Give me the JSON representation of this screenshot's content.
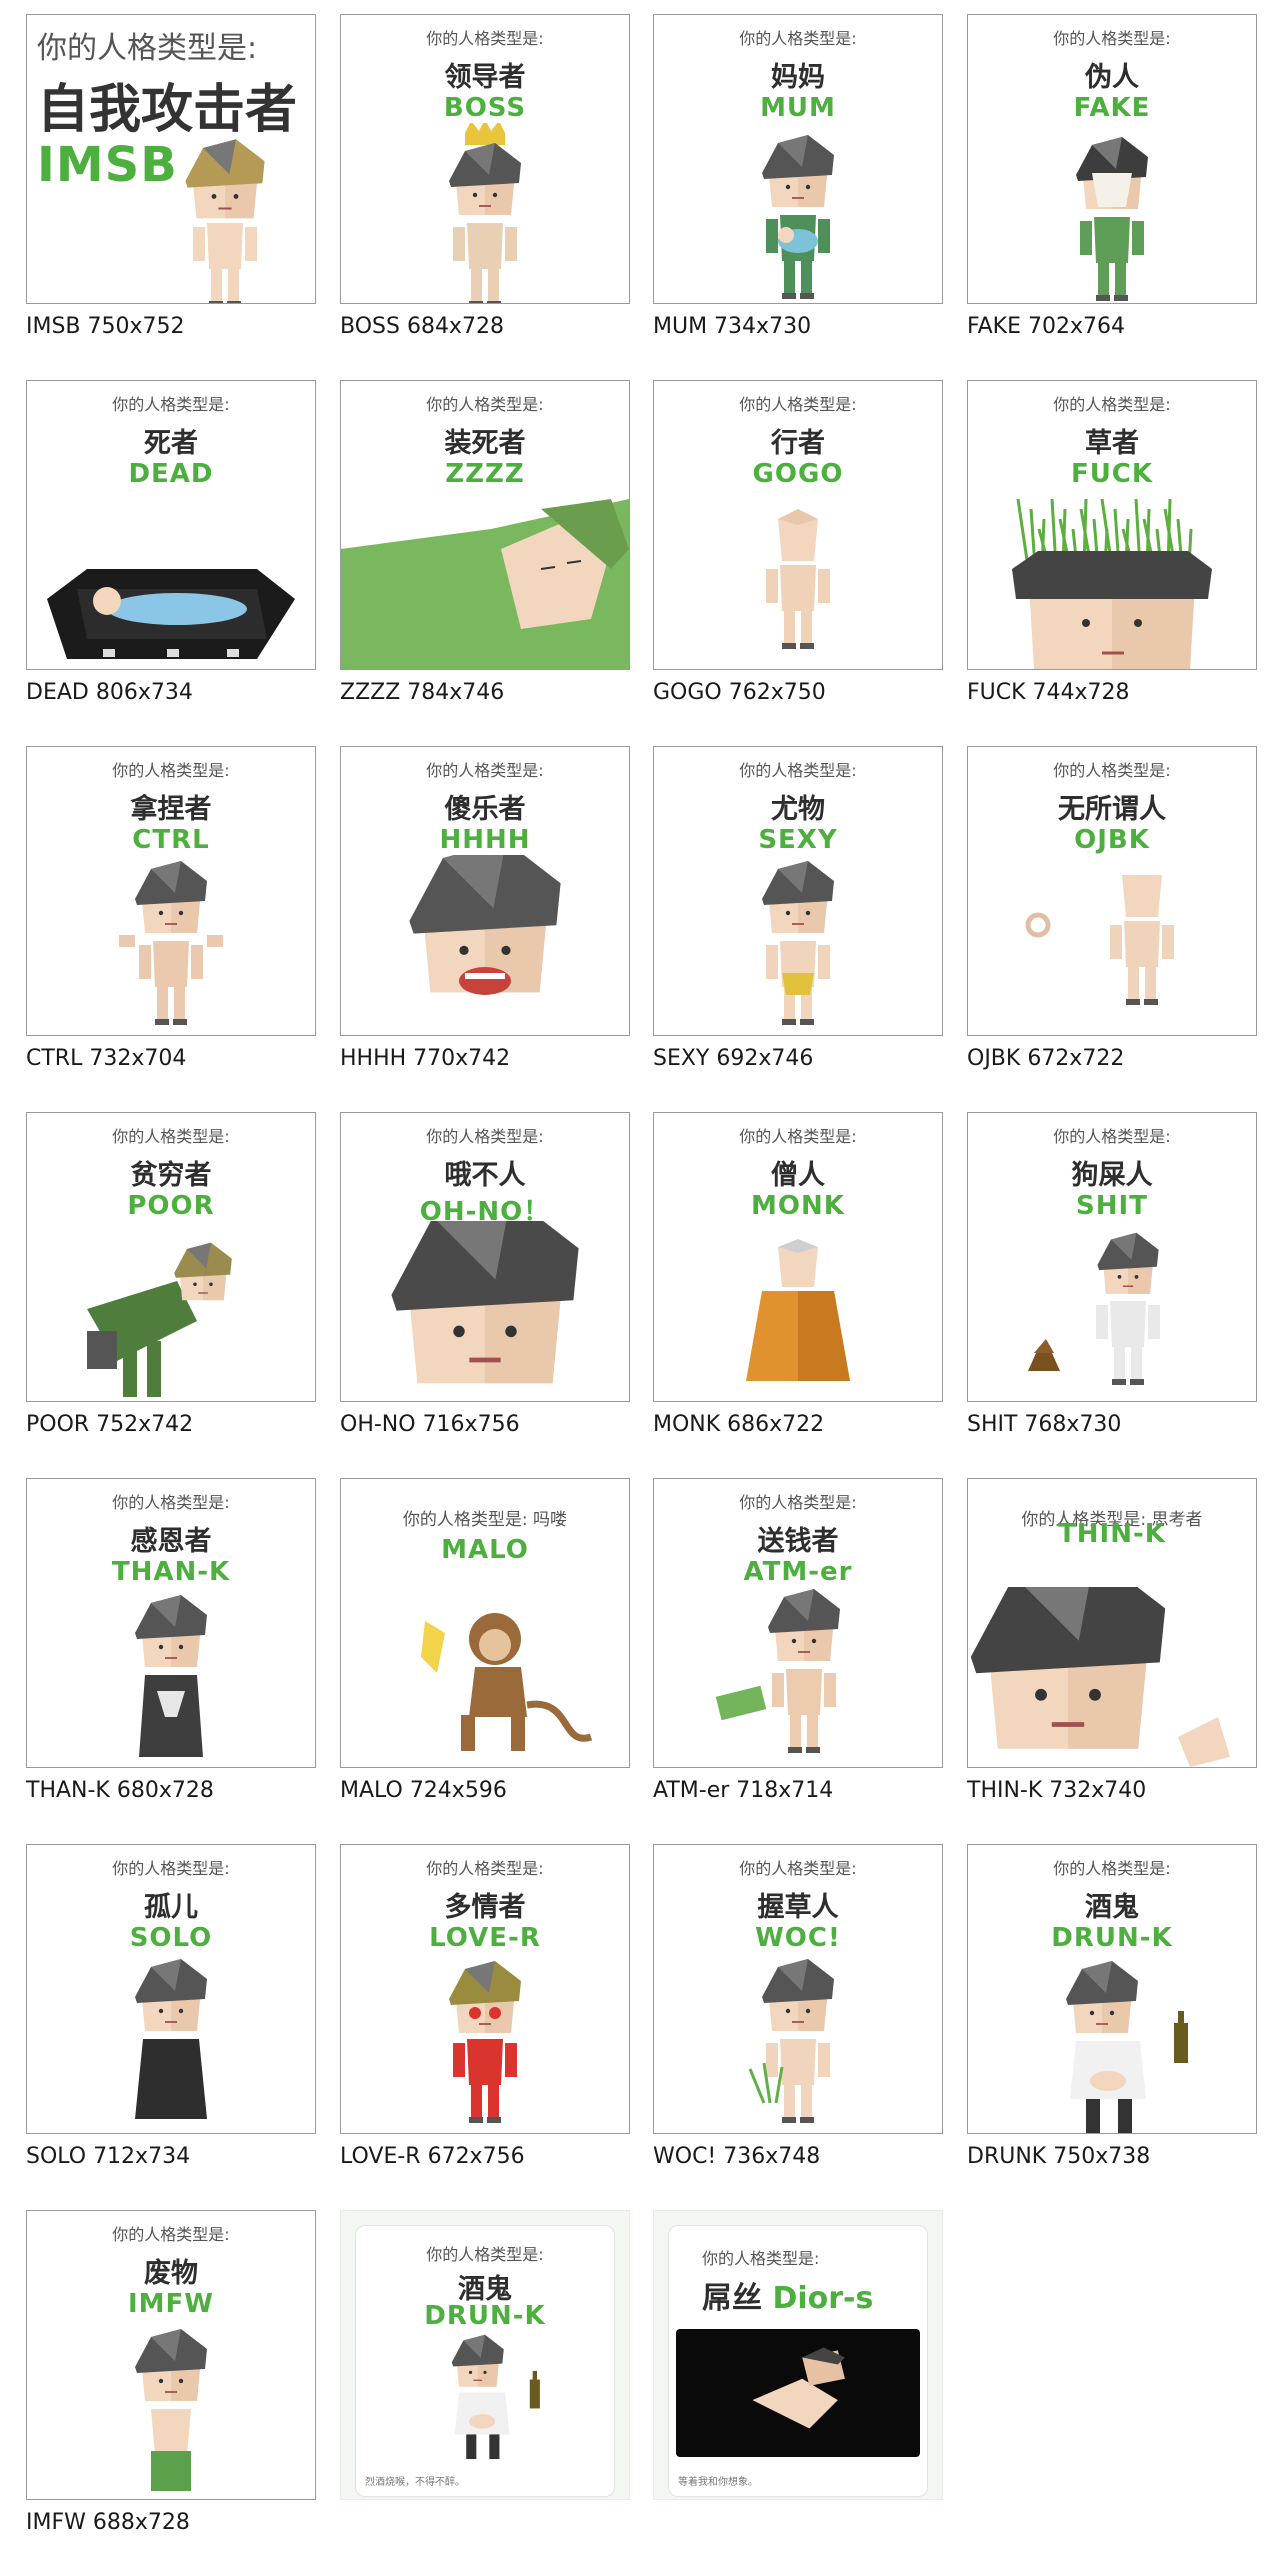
{
  "cards": [
    {
      "prompt": "你的人格类型是:",
      "name": "自我攻击者",
      "code": "IMSB",
      "caption": "IMSB 750x752",
      "icon": "blond-curly-haired-character-icon",
      "style": "big"
    },
    {
      "prompt": "你的人格类型是:",
      "name": "领导者",
      "code": "BOSS",
      "caption": "BOSS 684x728",
      "icon": "crowned-character-icon"
    },
    {
      "prompt": "你的人格类型是:",
      "name": "妈妈",
      "code": "MUM",
      "caption": "MUM 734x730",
      "icon": "character-holding-baby-icon"
    },
    {
      "prompt": "你的人格类型是:",
      "name": "伪人",
      "code": "FAKE",
      "caption": "FAKE 702x764",
      "icon": "masked-green-character-icon"
    },
    {
      "prompt": "你的人格类型是:",
      "name": "死者",
      "code": "DEAD",
      "caption": "DEAD 806x734",
      "icon": "character-in-coffin-icon"
    },
    {
      "prompt": "你的人格类型是:",
      "name": "装死者",
      "code": "ZZZZ",
      "caption": "ZZZZ 784x746",
      "icon": "sleeping-under-blanket-icon"
    },
    {
      "prompt": "你的人格类型是:",
      "name": "行者",
      "code": "GOGO",
      "caption": "GOGO 762x750",
      "icon": "walking-bald-character-icon"
    },
    {
      "prompt": "你的人格类型是:",
      "name": "草者",
      "code": "FUCK",
      "caption": "FUCK 744x728",
      "icon": "grass-haired-head-icon"
    },
    {
      "prompt": "你的人格类型是:",
      "name": "拿捏者",
      "code": "CTRL",
      "caption": "CTRL 732x704",
      "icon": "hands-up-character-icon"
    },
    {
      "prompt": "你的人格类型是:",
      "name": "傻乐者",
      "code": "HHHH",
      "caption": "HHHH 770x742",
      "icon": "laughing-character-icon"
    },
    {
      "prompt": "你的人格类型是:",
      "name": "尤物",
      "code": "SEXY",
      "caption": "SEXY 692x746",
      "icon": "posing-character-icon"
    },
    {
      "prompt": "你的人格类型是:",
      "name": "无所谓人",
      "code": "OJBK",
      "caption": "OJBK 672x722",
      "icon": "ok-gesture-character-icon"
    },
    {
      "prompt": "你的人格类型是:",
      "name": "贫穷者",
      "code": "POOR",
      "caption": "POOR 752x742",
      "icon": "bent-over-character-with-bag-icon"
    },
    {
      "prompt": "你的人格类型是:",
      "name": "哦不人",
      "code": "OH-NO！",
      "caption": "OH-NO 716x756",
      "icon": "worried-head-icon"
    },
    {
      "prompt": "你的人格类型是:",
      "name": "僧人",
      "code": "MONK",
      "caption": "MONK 686x722",
      "icon": "meditating-monk-icon"
    },
    {
      "prompt": "你的人格类型是:",
      "name": "狗屎人",
      "code": "SHIT",
      "caption": "SHIT 768x730",
      "icon": "character-with-poop-icon"
    },
    {
      "prompt": "你的人格类型是:",
      "name": "感恩者",
      "code": "THAN-K",
      "caption": "THAN-K 680x728",
      "icon": "kneeling-praying-character-icon"
    },
    {
      "prompt": "你的人格类型是:  吗喽",
      "name": "",
      "code": "MALO",
      "caption": "MALO 724x596",
      "icon": "monkey-with-banana-icon",
      "style": "malo"
    },
    {
      "prompt": "你的人格类型是:",
      "name": "送钱者",
      "code": "ATM-er",
      "caption": "ATM-er 718x714",
      "icon": "character-holding-money-icon"
    },
    {
      "prompt": "你的人格类型是:  思考者",
      "name": "",
      "code": "THIN-K",
      "caption": "THIN-K 732x740",
      "icon": "thinking-head-icon",
      "style": "think"
    },
    {
      "prompt": "你的人格类型是:",
      "name": "孤儿",
      "code": "SOLO",
      "caption": "SOLO 712x734",
      "icon": "sitting-alone-character-icon"
    },
    {
      "prompt": "你的人格类型是:",
      "name": "多情者",
      "code": "LOVE-R",
      "caption": "LOVE-R 672x756",
      "icon": "heart-eyed-character-icon"
    },
    {
      "prompt": "你的人格类型是:",
      "name": "握草人",
      "code": "WOC!",
      "caption": "WOC! 736x748",
      "icon": "character-holding-grass-icon"
    },
    {
      "prompt": "你的人格类型是:",
      "name": "酒鬼",
      "code": "DRUN-K",
      "caption": "DRUNK 750x738",
      "icon": "drunk-character-with-bottle-icon"
    },
    {
      "prompt": "你的人格类型是:",
      "name": "废物",
      "code": "IMFW",
      "caption": "IMFW 688x728",
      "icon": "crying-character-icon"
    },
    {
      "prompt": "你的人格类型是:",
      "name": "酒鬼",
      "code": "DRUN-K",
      "caption": "",
      "icon": "drunk-character-with-bottle-icon",
      "style": "soft",
      "foot": "烈酒烧喉，不得不醉。"
    },
    {
      "prompt": "你的人格类型是:",
      "name": "屌丝",
      "code": "Dior-s",
      "caption": "",
      "icon": "reclining-character-on-dark-icon",
      "style": "soft-dark",
      "foot": "等着我和你想象。"
    }
  ],
  "colors": {
    "accent": "#4caf3e",
    "title": "#2e2e2e",
    "prompt": "#555555",
    "border": "#9a9a9a"
  }
}
